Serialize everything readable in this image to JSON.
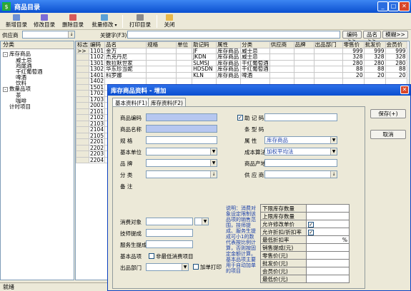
{
  "window": {
    "title": "商品目录"
  },
  "toolbar": {
    "items": [
      "新增目录",
      "修改目录",
      "删除目录",
      "批量修改",
      "打印目录",
      "关闭"
    ]
  },
  "filter": {
    "supplier_label": "供应商",
    "keyword_label": "关键字(F3)",
    "buttons": [
      "编码>>",
      "品名>>",
      "模糊>>"
    ]
  },
  "tree": {
    "header": "分类",
    "items": [
      "库存商品",
      "威士忌",
      "鸡尾酒",
      "干红葡萄酒",
      "啤酒",
      "饮料",
      "数量品项",
      "茶",
      "咖啡",
      "计时项目"
    ]
  },
  "grid": {
    "columns": [
      "标志",
      "编码",
      "品名",
      "规格",
      "单位",
      "助记码",
      "属性",
      "分类",
      "供应商",
      "品牌",
      "出品部门",
      "零售价",
      "批发价",
      "会员价"
    ],
    "rows": [
      {
        "flag": ">>",
        "code": "1101",
        "name": "金万",
        "spec": "",
        "unit": "",
        "mnemonic": "JF",
        "attr": "库存商品",
        "category": "威士忌",
        "supplier": "",
        "brand": "",
        "dept": "",
        "retail": "999",
        "wholesale": "999",
        "member": "999"
      },
      {
        "flag": "",
        "code": "1102",
        "name": "杰克丹尼",
        "spec": "",
        "unit": "",
        "mnemonic": "JKDN",
        "attr": "库存商品",
        "category": "威士忌",
        "supplier": "",
        "brand": "",
        "dept": "",
        "retail": "328",
        "wholesale": "328",
        "member": "328"
      },
      {
        "flag": "",
        "code": "1301",
        "name": "数拉默世家",
        "spec": "",
        "unit": "",
        "mnemonic": "SLMSJ",
        "attr": "库存商品",
        "category": "干红葡萄酒",
        "supplier": "",
        "brand": "",
        "dept": "",
        "retail": "280",
        "wholesale": "280",
        "member": "280"
      },
      {
        "flag": "",
        "code": "1302",
        "name": "华东珍当妮",
        "spec": "",
        "unit": "",
        "mnemonic": "HDSDN",
        "attr": "库存商品",
        "category": "干红葡萄酒",
        "supplier": "",
        "brand": "",
        "dept": "",
        "retail": "88",
        "wholesale": "88",
        "member": "88"
      },
      {
        "flag": "",
        "code": "1401",
        "name": "科罗娜",
        "spec": "",
        "unit": "",
        "mnemonic": "KLN",
        "attr": "库存商品",
        "category": "啤酒",
        "supplier": "",
        "brand": "",
        "dept": "",
        "retail": "20",
        "wholesale": "20",
        "member": "20"
      },
      {
        "flag": "",
        "code": "1402"
      },
      {
        "flag": "",
        "code": "1501"
      },
      {
        "flag": "",
        "code": "1702"
      },
      {
        "flag": "",
        "code": "1703"
      },
      {
        "flag": "",
        "code": "2001"
      },
      {
        "flag": "",
        "code": "2101"
      },
      {
        "flag": "",
        "code": "2102"
      },
      {
        "flag": "",
        "code": "2103"
      },
      {
        "flag": "",
        "code": "2104"
      },
      {
        "flag": "",
        "code": "2105"
      },
      {
        "flag": "",
        "code": "2201"
      },
      {
        "flag": "",
        "code": "2202"
      },
      {
        "flag": "",
        "code": "2203"
      },
      {
        "flag": "",
        "code": "2204"
      }
    ]
  },
  "status": {
    "text": "就绪"
  },
  "dialog": {
    "title": "库存商品资料 - 增加",
    "tabs": [
      "基本资料(F1)",
      "库存资料(F2)"
    ],
    "left_labels": [
      "商品编码",
      "商品名称",
      "规 格",
      "基本单位",
      "品 牌",
      "分 类",
      "备 注"
    ],
    "right_labels": [
      "助 记 码",
      "条 型 码",
      "属 性",
      "成本算法",
      "商品产地",
      "供 应 商"
    ],
    "attr_value": "库存商品",
    "cost_value": "加权平均法",
    "save_label": "保存(+)",
    "cancel_label": "取消",
    "lower_labels": [
      "消费对象",
      "技师提成",
      "服务生提成",
      "基本品项",
      "出品部门"
    ],
    "not_min_label": "非最低消费项目",
    "add_print_label": "加单打印",
    "note": "说明：消费对象设定限制该品项的销售范围，技师提成、服务生提成可小1的数代表按比例计算，否则按固定金额计算。基本品项主要用于自动加单的项目",
    "props": [
      "下限库存数量",
      "上限库存数量",
      "允许修改单价",
      "允许折扣/折扣率",
      "最低折扣率",
      "销售提成(元)",
      "零售价(元)",
      "批发价(元)",
      "会员价(元)",
      "最低价(元)"
    ],
    "pct": "%"
  }
}
